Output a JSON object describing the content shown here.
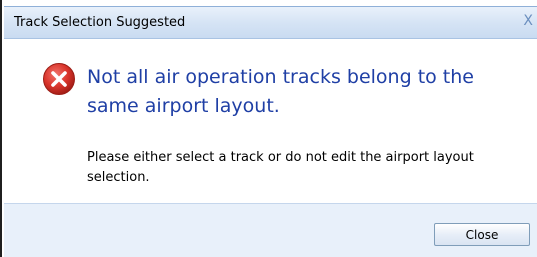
{
  "dialog": {
    "title": "Track Selection Suggested",
    "close_glyph": "X",
    "icon": "error-icon",
    "heading": "Not all air operation tracks belong to the same airport layout.",
    "message": "Please either select a track or do not edit the airport layout selection.",
    "close_button_label": "Close"
  },
  "colors": {
    "heading": "#1f3fa5",
    "error_icon": "#d9342b",
    "titlebar": "#d6e4f5",
    "footer": "#e8f0fa"
  }
}
